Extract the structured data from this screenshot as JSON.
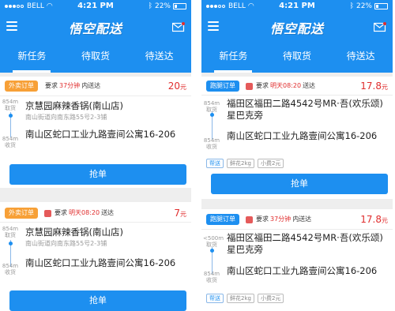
{
  "left": {
    "status": {
      "carrier": "BELL",
      "time": "4:21 PM",
      "battery": "22%"
    },
    "brand": "悟空配送",
    "tabs": [
      "新任务",
      "待取货",
      "待送达"
    ],
    "cards": [
      {
        "chip": "外卖订单",
        "req_prefix": "要求",
        "req_highlight": "37分钟",
        "req_suffix": "内送达",
        "price": "20",
        "price_unit": "元",
        "pickup_dist": "854m",
        "pickup_label": "取货",
        "pickup_name": "京慧园麻辣香锅(南山店)",
        "pickup_sub": "南山街道向南东路55号2-3铺",
        "deliver_dist": "854m",
        "deliver_label": "收货",
        "deliver_addr": "南山区蛇口工业九路壹间公寓16-206",
        "button": "抢单"
      },
      {
        "chip": "外卖订单",
        "req_prefix": "要求",
        "req_highlight": "明天08:20",
        "req_suffix": "送达",
        "price": "7",
        "price_unit": "元",
        "pickup_dist": "854m",
        "pickup_label": "取货",
        "pickup_name": "京慧园麻辣香锅(南山店)",
        "pickup_sub": "南山街道向南东路55号2-3铺",
        "deliver_dist": "854m",
        "deliver_label": "收货",
        "deliver_addr": "南山区蛇口工业九路壹间公寓16-206",
        "button": "抢单"
      }
    ]
  },
  "right": {
    "status": {
      "carrier": "BELL",
      "time": "4:21 PM",
      "battery": "22%"
    },
    "brand": "悟空配送",
    "tabs": [
      "新任务",
      "待取货",
      "待送达"
    ],
    "cards": [
      {
        "chip": "跑腿订单",
        "req_prefix": "要求",
        "req_highlight": "明天08:20",
        "req_suffix": "送达",
        "price": "17.8",
        "price_unit": "元",
        "pickup_dist": "854m",
        "pickup_label": "取货",
        "pickup_name": "福田区福田二路4542号MR·吾(欢乐颂)星巴克旁",
        "deliver_dist": "854m",
        "deliver_label": "收货",
        "deliver_addr": "南山区蛇口工业九路壹间公寓16-206",
        "tags": [
          "帮送",
          "鲜花2kg",
          "小费2元"
        ],
        "button": "抢单"
      },
      {
        "chip": "跑腿订单",
        "req_prefix": "要求",
        "req_highlight": "37分钟",
        "req_suffix": "内送达",
        "price": "17.8",
        "price_unit": "元",
        "pickup_dist": "<500m",
        "pickup_label": "取货",
        "pickup_name": "福田区福田二路4542号MR·吾(欢乐颂)星巴克旁",
        "deliver_dist": "854m",
        "deliver_label": "收货",
        "deliver_addr": "南山区蛇口工业九路壹间公寓16-206",
        "tags": [
          "帮送",
          "鲜花2kg",
          "小费2元"
        ]
      }
    ]
  },
  "colors": {
    "primary": "#1d8ff0",
    "accent_orange": "#f7a037",
    "price_red": "#e02d2d"
  }
}
